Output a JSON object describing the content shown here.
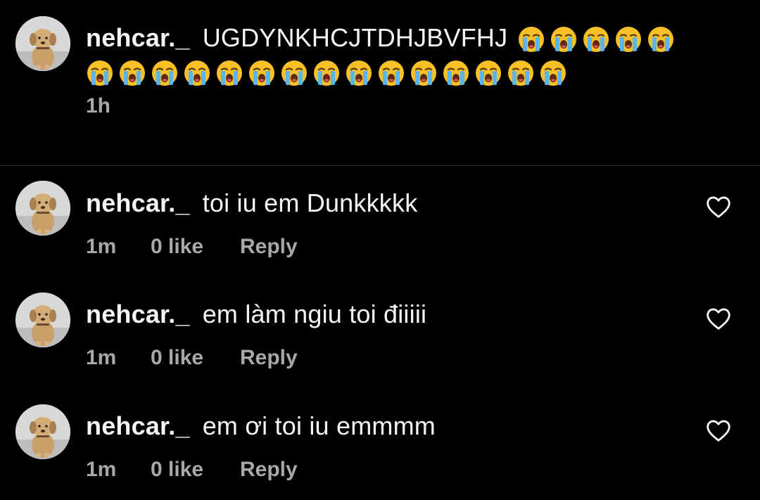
{
  "colors": {
    "background": "#000000",
    "text": "#f5f5f5",
    "meta": "#a8a8a8",
    "divider": "#262626",
    "emoji_face": "#f6c026",
    "emoji_tears": "#5ab4f0"
  },
  "caption": {
    "username": "nehcar._",
    "text": "UGDYNKHCJTDHJBVFHJ",
    "emoji_icon": "loudly-crying-face-emoji",
    "emoji_count_line1": 5,
    "emoji_count_line2": 15,
    "time": "1h"
  },
  "comments": [
    {
      "username": "nehcar._",
      "text": "toi iu em Dunkkkkk",
      "time": "1m",
      "likes": "0 like",
      "reply": "Reply",
      "like_icon": "heart-outline-icon"
    },
    {
      "username": "nehcar._",
      "text": "em làm ngiu toi điiiii",
      "time": "1m",
      "likes": "0 like",
      "reply": "Reply",
      "like_icon": "heart-outline-icon"
    },
    {
      "username": "nehcar._",
      "text": "em ơi toi iu emmmm",
      "time": "1m",
      "likes": "0 like",
      "reply": "Reply",
      "like_icon": "heart-outline-icon"
    }
  ]
}
